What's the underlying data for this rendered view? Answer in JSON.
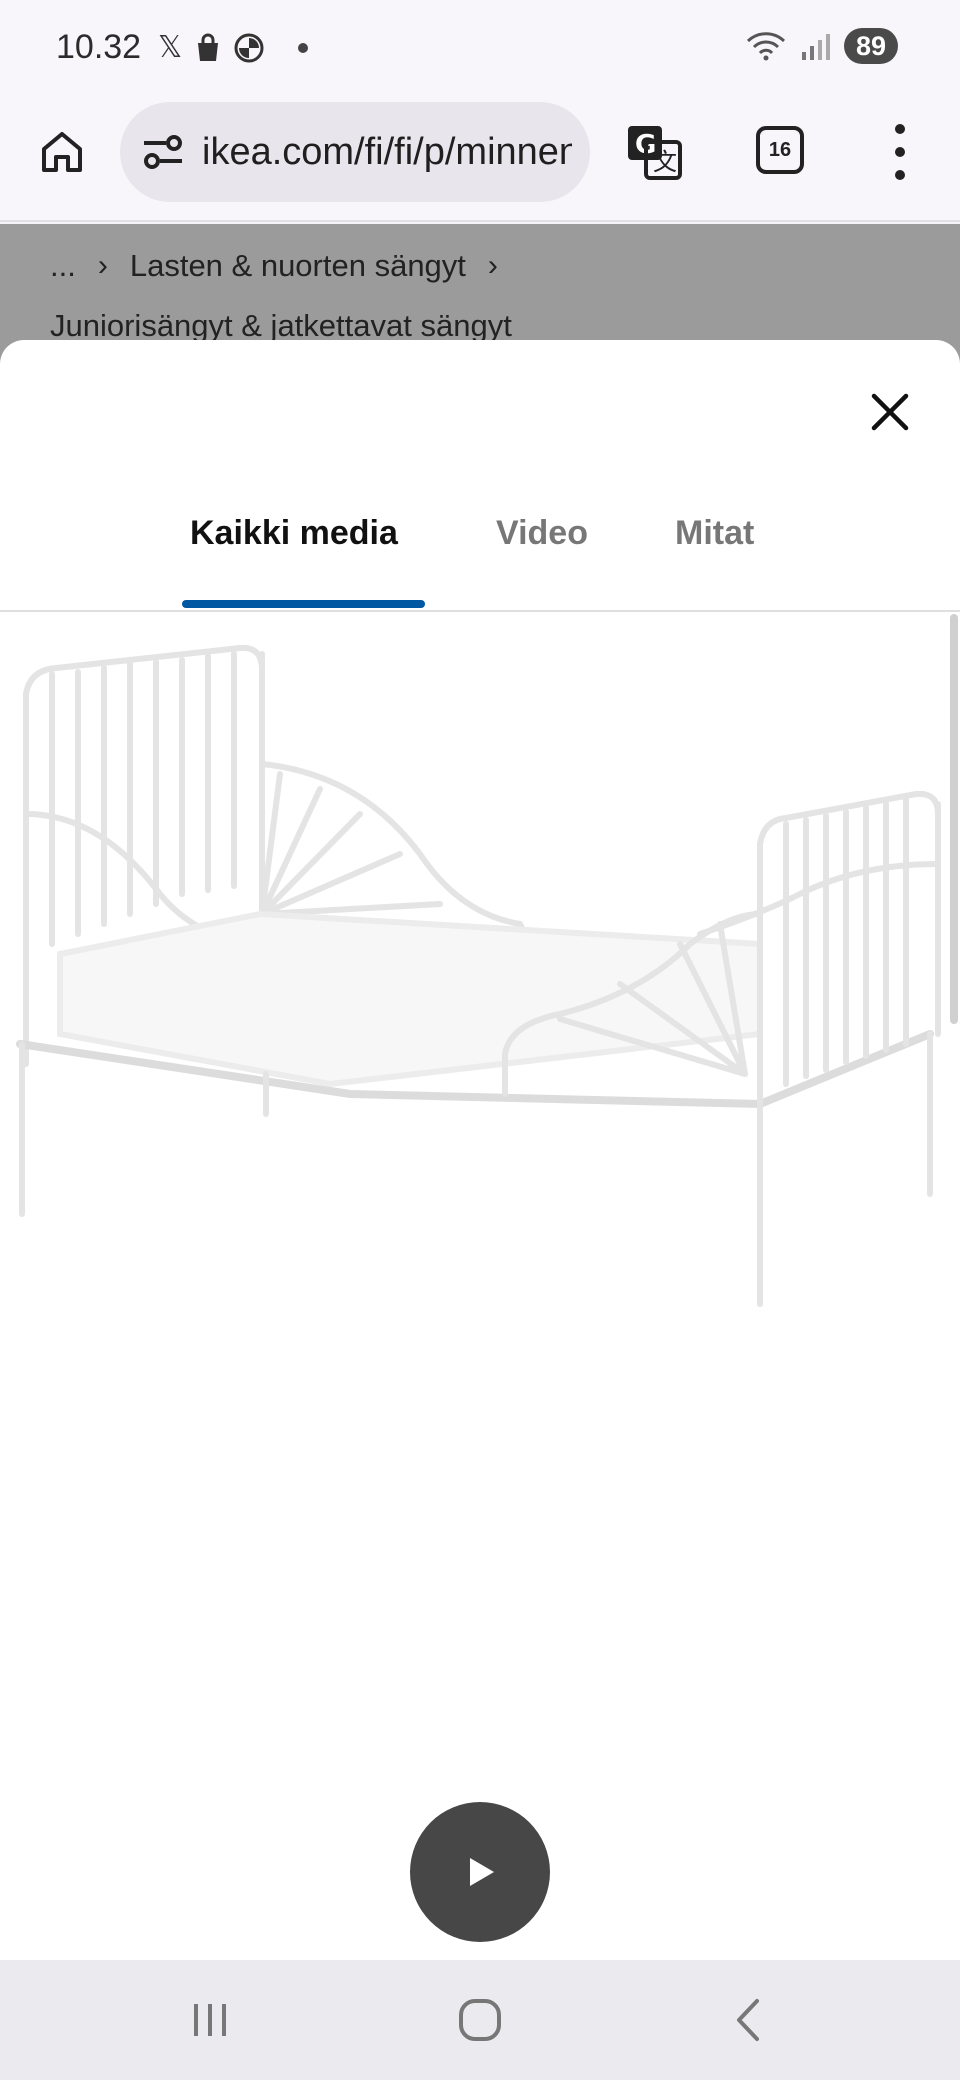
{
  "status_bar": {
    "time": "10.32",
    "icons": [
      "x-app-icon",
      "shopping-bag-icon",
      "bmw-icon"
    ],
    "battery": "89"
  },
  "browser": {
    "url": "ikea.com/fi/fi/p/minnen",
    "tab_count": "16"
  },
  "breadcrumb": {
    "ellipsis": "...",
    "items": [
      "Lasten & nuorten sängyt",
      "Juniorisängyt & jatkettavat sängyt"
    ]
  },
  "media_modal": {
    "tabs": [
      {
        "label": "Kaikki media",
        "active": true
      },
      {
        "label": "Video",
        "active": false
      },
      {
        "label": "Mitat",
        "active": false
      }
    ],
    "accent_color": "#0058a3"
  }
}
